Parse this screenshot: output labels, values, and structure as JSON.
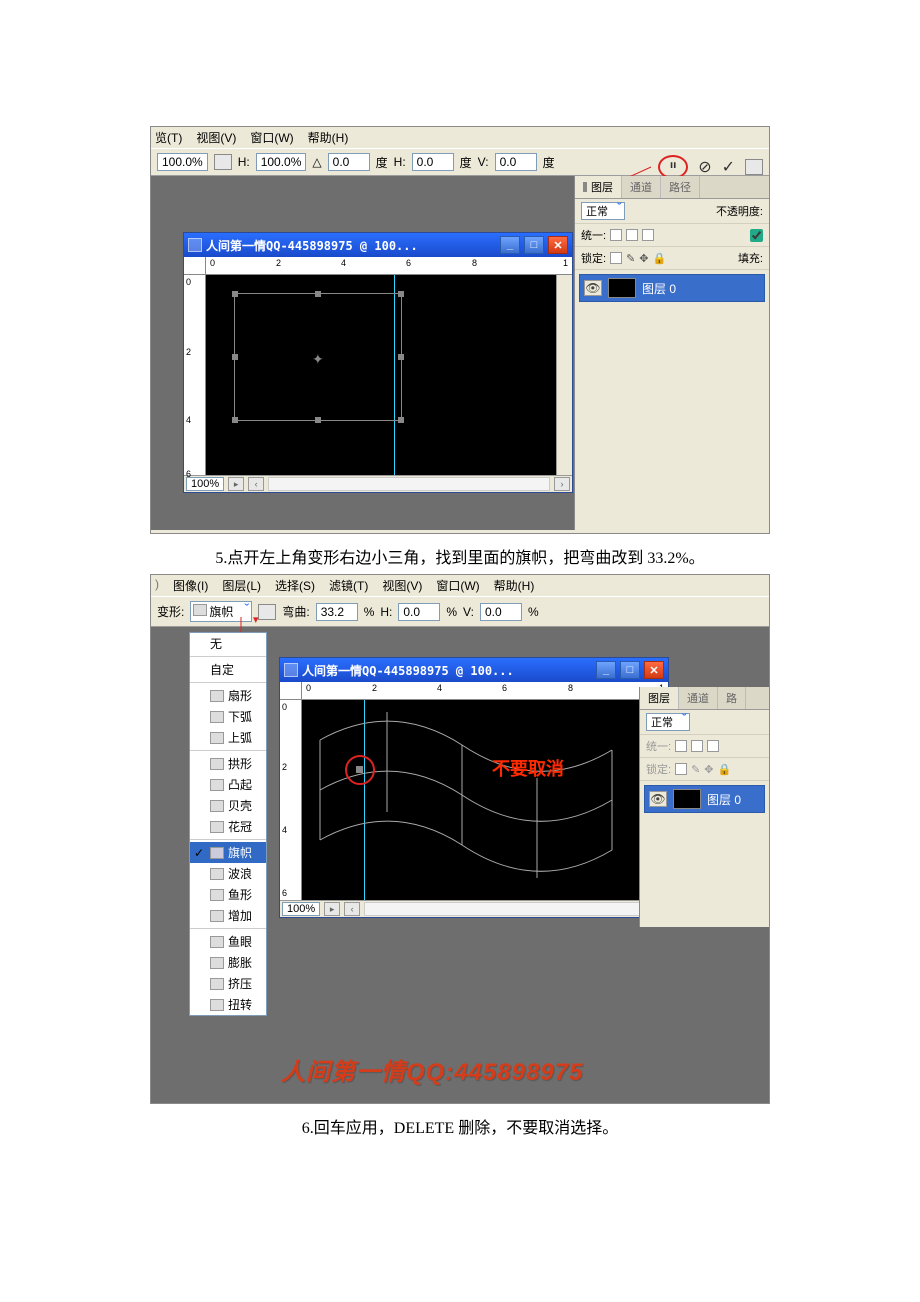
{
  "shot1": {
    "menu": {
      "t": "览(T)",
      "view": "视图(V)",
      "window": "窗口(W)",
      "help": "帮助(H)"
    },
    "optbar": {
      "zoom": "100.0%",
      "h_label": "H:",
      "h": "100.0%",
      "angle": "0.0",
      "deg1": "度",
      "hh_label": "H:",
      "hh": "0.0",
      "deg2": "度",
      "v_label": "V:",
      "v": "0.0",
      "deg3": "度"
    },
    "doc": {
      "title": "人间第一情QQ-445898975 @ 100...",
      "zoom": "100%"
    },
    "layers": {
      "tabs": [
        "图层",
        "通道",
        "路径"
      ],
      "mode": "正常",
      "opacity_label": "不透明度:",
      "unify": "统一:",
      "lock": "锁定:",
      "fill": "填充:",
      "layer0": "图层 0"
    },
    "righticons": {
      "cancel": "⊘",
      "commit": "✓"
    }
  },
  "caption5": "5.点开左上角变形右边小三角，找到里面的旗帜，把弯曲改到 33.2%。",
  "shot2": {
    "menu": {
      "image": "图像(I)",
      "layer": "图层(L)",
      "select": "选择(S)",
      "filter": "滤镜(T)",
      "view": "视图(V)",
      "window": "窗口(W)",
      "help": "帮助(H)"
    },
    "optbar": {
      "warp_label": "变形:",
      "warp_sel": "旗帜",
      "bend_label": "弯曲:",
      "bend": "33.2",
      "pct1": "%",
      "h_label": "H:",
      "h": "0.0",
      "pct2": "%",
      "v_label": "V:",
      "v": "0.0",
      "pct3": "%"
    },
    "dropdown": {
      "none": "无",
      "custom": "自定",
      "group1": [
        "扇形",
        "下弧",
        "上弧"
      ],
      "group2": [
        "拱形",
        "凸起",
        "贝壳",
        "花冠"
      ],
      "group3": [
        "旗帜",
        "波浪",
        "鱼形",
        "增加"
      ],
      "group4": [
        "鱼眼",
        "膨胀",
        "挤压",
        "扭转"
      ]
    },
    "doc": {
      "title": "人间第一情QQ-445898975 @ 100...",
      "zoom": "100%"
    },
    "red_annot": "不要取消",
    "layers": {
      "tabs": [
        "图层",
        "通道",
        "路"
      ],
      "mode": "正常",
      "unify": "统一:",
      "lock": "锁定:",
      "layer0": "图层 0"
    },
    "watermark": "人间第一情QQ:445898975"
  },
  "caption6": "6.回车应用，DELETE 删除，不要取消选择。"
}
